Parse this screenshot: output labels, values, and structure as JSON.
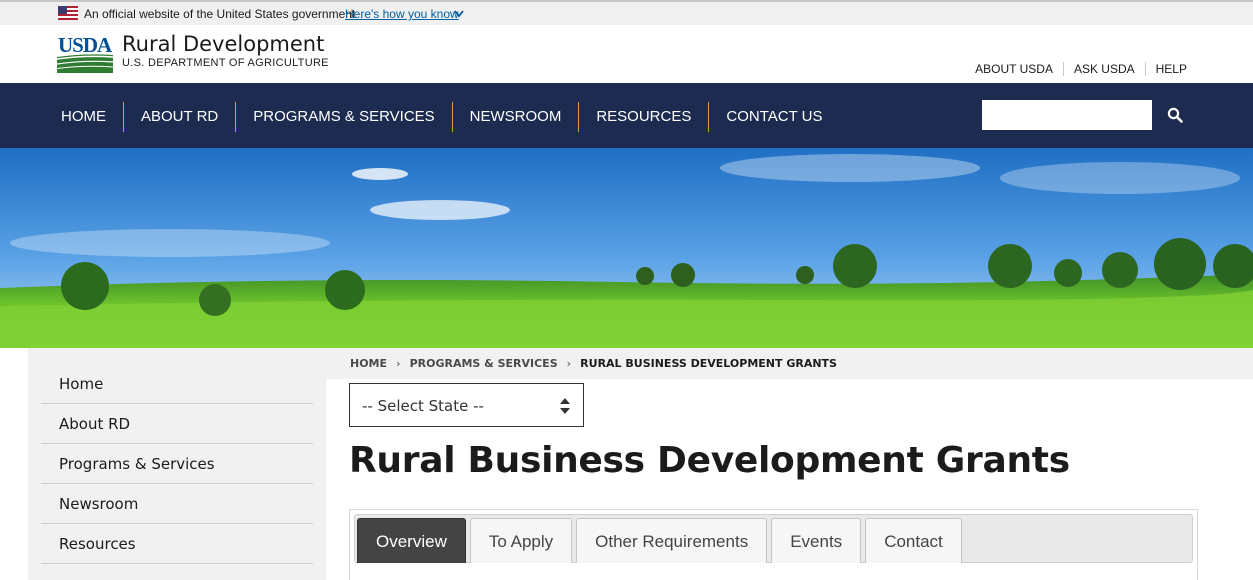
{
  "gov_banner": {
    "text": "An official website of the United States government",
    "link": "Here's how you know"
  },
  "header": {
    "logo_text": "USDA",
    "site_name": "Rural Development",
    "site_sub": "U.S. DEPARTMENT OF AGRICULTURE",
    "util_links": [
      "ABOUT USDA",
      "ASK USDA",
      "HELP"
    ]
  },
  "nav": {
    "items": [
      "HOME",
      "ABOUT RD",
      "PROGRAMS & SERVICES",
      "NEWSROOM",
      "RESOURCES",
      "CONTACT US"
    ],
    "search_placeholder": ""
  },
  "sidebar": {
    "items": [
      "Home",
      "About RD",
      "Programs & Services",
      "Newsroom",
      "Resources"
    ]
  },
  "breadcrumb": {
    "items": [
      "HOME",
      "PROGRAMS & SERVICES",
      "RURAL BUSINESS DEVELOPMENT GRANTS"
    ]
  },
  "state_select": {
    "selected": "-- Select State --"
  },
  "page": {
    "title": "Rural Business Development Grants"
  },
  "tabs": {
    "items": [
      "Overview",
      "To Apply",
      "Other Requirements",
      "Events",
      "Contact"
    ],
    "active": "Overview"
  },
  "colors": {
    "nav_bg": "#1c2b4f",
    "nav_divider": "#d1a03b",
    "link": "#005ea2",
    "active_tab": "#444444"
  }
}
